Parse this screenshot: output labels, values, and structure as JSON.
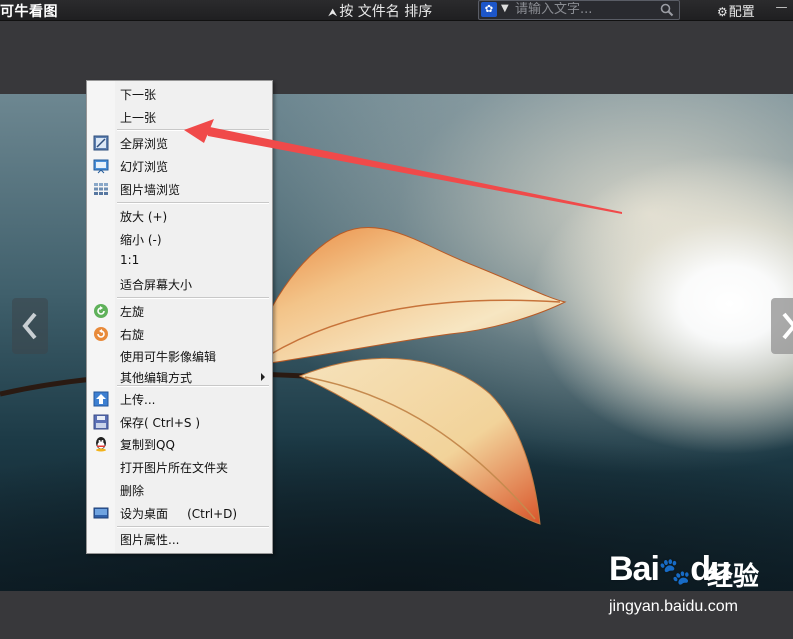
{
  "app": {
    "title": "可牛看图"
  },
  "topbar": {
    "sort_label": "按 文件名 排序",
    "search_placeholder": "请输入文字...",
    "config_label": "配置",
    "minimize_label": "—"
  },
  "context_menu": {
    "items": [
      {
        "label": "下一张",
        "icon": null
      },
      {
        "label": "上一张",
        "icon": null
      },
      {
        "label": "全屏浏览",
        "icon": "fullscreen-icon"
      },
      {
        "label": "幻灯浏览",
        "icon": "slideshow-icon"
      },
      {
        "label": "图片墙浏览",
        "icon": "image-wall-icon"
      },
      {
        "label": "放大 (+)",
        "icon": null
      },
      {
        "label": "缩小 (-)",
        "icon": null
      },
      {
        "label": "1:1",
        "icon": null
      },
      {
        "label": "适合屏幕大小",
        "icon": null
      },
      {
        "label": "左旋",
        "icon": "rotate-left-icon"
      },
      {
        "label": "右旋",
        "icon": "rotate-right-icon"
      },
      {
        "label": "使用可牛影像编辑",
        "icon": null
      },
      {
        "label": "其他编辑方式",
        "icon": null,
        "submenu": true
      },
      {
        "label": "上传...",
        "icon": "upload-icon"
      },
      {
        "label": "保存( Ctrl+S )",
        "icon": "save-icon"
      },
      {
        "label": "复制到QQ",
        "icon": "qq-icon"
      },
      {
        "label": "打开图片所在文件夹",
        "icon": null
      },
      {
        "label": "删除",
        "icon": null
      },
      {
        "label": "设为桌面     (Ctrl+D)",
        "icon": "desktop-icon"
      },
      {
        "label": "图片属性...",
        "icon": null
      }
    ]
  },
  "watermark": {
    "brand": "Bai",
    "brand2": "du",
    "product": "经验",
    "url": "jingyan.baidu.com"
  },
  "colors": {
    "annotation_arrow": "#f04a4a",
    "menu_bg": "#f0f0f0"
  }
}
